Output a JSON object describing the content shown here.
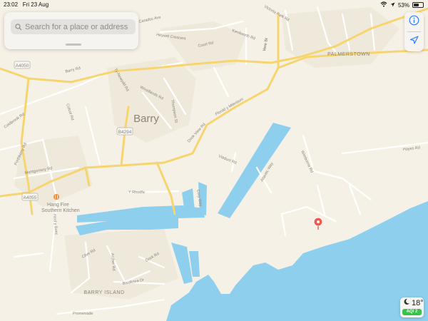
{
  "status_bar": {
    "time": "23:02",
    "date": "Fri 23 Aug",
    "battery": "53%",
    "battery_level": 0.53
  },
  "search": {
    "placeholder": "Search for a place or address"
  },
  "map": {
    "areas": {
      "barry": "Barry",
      "palmerstown": "PALMERSTOWN",
      "barry_island": "BARRY ISLAND"
    },
    "roads": {
      "a4050": "A4050",
      "a4055": "A4055",
      "b4294": "B4294",
      "barry_rd": "Barry Rd",
      "ty_newydd_rd": "Ty-Newydd Rd",
      "woodlands_rd": "Woodlands Rd",
      "court_rd": "Court Rd",
      "kenilworth_rd": "Kenilworth Rd",
      "victoria_park_rd": "Victoria Park Rd",
      "caradoc_ave": "Caradoc Ave",
      "heywel_crescent": "Heywel Crescent",
      "vere_st": "Vere St",
      "dock_view_rd": "Dock View Rd",
      "thompson_st": "Thompson St",
      "hayes_rd": "Hayes Rd",
      "viaduct_rd": "Viaduct Rd",
      "atlantic_way": "Atlantic Way",
      "wimborne_rd": "Wimborne Rd",
      "heol_y_bonc": "Heol y Bonc",
      "porthkerry_rd": "Porthkerry Rd",
      "montgomery_rd": "Montgomery Rd",
      "coldbrook_rd": "Coldbrook Rd",
      "colcot_rd": "Colcot Rd",
      "clive_rd": "Clive Rd",
      "archer_rd": "Archer Rd",
      "breaksea_dr": "Breaksea Dr",
      "promenade": "Promenade",
      "y_rhodfa": "Y Rhodfa",
      "dock_rd": "Dock Rd",
      "cory_way": "Cory Way",
      "hoel_y_mor": "Ffordd y Mileniwm"
    },
    "poi": {
      "restaurant": "Hang Fire Southern Kitchen"
    },
    "pin": "pin-icon"
  },
  "controls": {
    "info_icon": "info-icon",
    "location_icon": "location-arrow-icon"
  },
  "weather": {
    "temperature": "18°",
    "aqi": "AQI 2"
  },
  "colors": {
    "land": "#f6f1e7",
    "water": "#8fcfee",
    "road_major": "#f7d56e",
    "road_minor": "#ffffff",
    "pin": "#f0584a",
    "accent": "#2f7cf6"
  }
}
